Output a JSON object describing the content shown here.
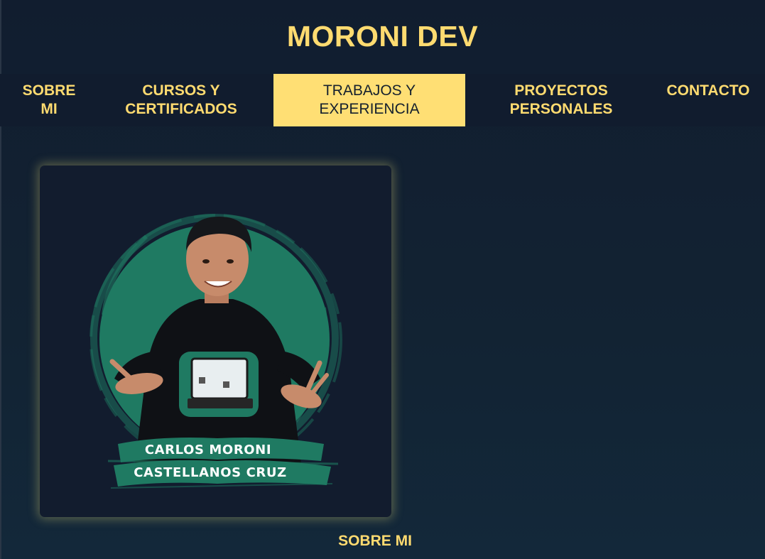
{
  "header": {
    "title": "MORONI DEV"
  },
  "nav": {
    "items": [
      {
        "line1": "SOBRE",
        "line2": "MI",
        "active": false
      },
      {
        "line1": "CURSOS Y",
        "line2": "CERTIFICADOS",
        "active": false
      },
      {
        "line1": "TRABAJOS Y",
        "line2": "EXPERIENCIA",
        "active": true
      },
      {
        "line1": "PROYECTOS",
        "line2": "PERSONALES",
        "active": false
      },
      {
        "line1": "CONTACTO",
        "line2": "",
        "active": false
      }
    ]
  },
  "profile": {
    "name_line1": "CARLOS MORONI",
    "name_line2": "CASTELLANOS CRUZ",
    "caption": "SOBRE MI"
  },
  "colors": {
    "accent": "#ffdb70",
    "background": "#122333",
    "card": "#121c2e",
    "brush_green": "#1f7a62"
  }
}
